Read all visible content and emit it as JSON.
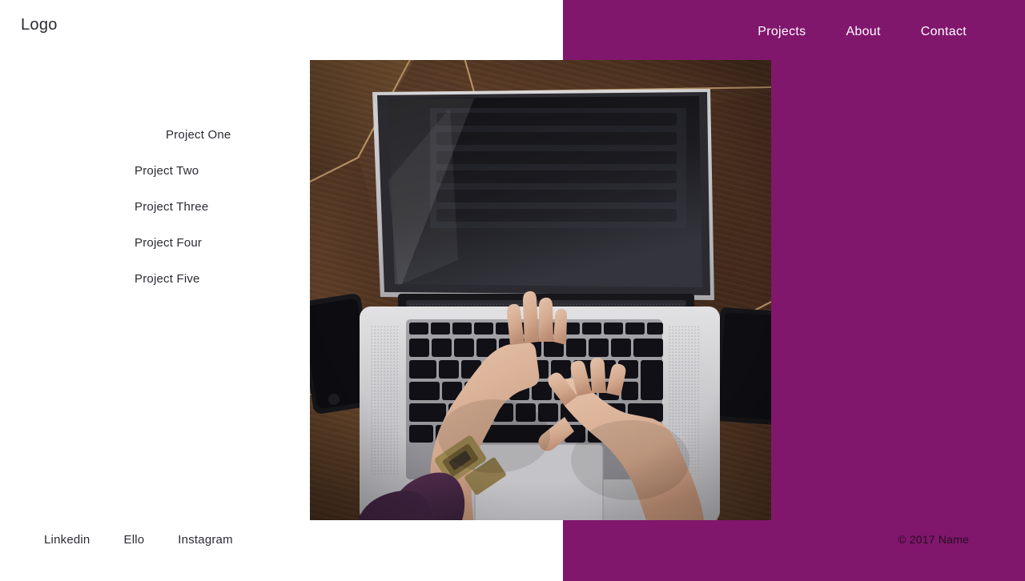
{
  "site": {
    "logo": "Logo",
    "background_color": "#ffffff",
    "accent_color": "#81166d",
    "text_color": "#2a2a33"
  },
  "nav": {
    "items": [
      {
        "label": "Projects"
      },
      {
        "label": "About"
      },
      {
        "label": "Contact"
      }
    ]
  },
  "projects": {
    "items": [
      {
        "label": "Project One"
      },
      {
        "label": "Project Two"
      },
      {
        "label": "Project Three"
      },
      {
        "label": "Project Four"
      },
      {
        "label": "Project Five"
      }
    ]
  },
  "hero": {
    "image_alt": "Overhead photo of two hands typing on a silver laptop on a dark walnut wood desk, with a black phone, a black wallet and a gold wristwatch",
    "colors": {
      "wood_dark": "#43291c",
      "wood_mid": "#6b4a32",
      "wood_light_inlay": "#c9a271",
      "laptop_silver": "#cfcfd1",
      "screen_black": "#15151a",
      "skin": "#d8b098",
      "sleeve_purple": "#4a2844",
      "watch_gold": "#9c8752"
    }
  },
  "footer": {
    "social": [
      {
        "label": "Linkedin"
      },
      {
        "label": "Ello"
      },
      {
        "label": "Instagram"
      }
    ],
    "copyright": "© 2017 Name"
  }
}
